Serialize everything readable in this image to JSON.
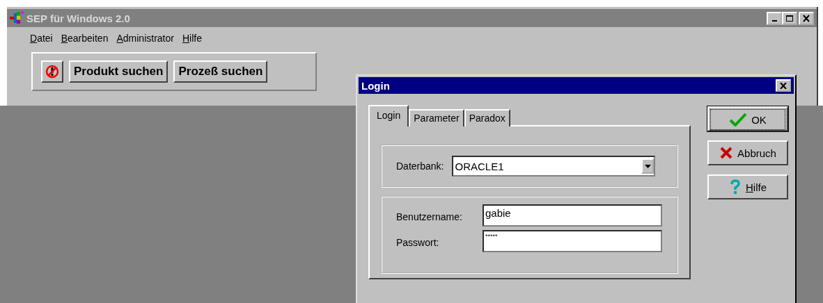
{
  "window": {
    "title": "SEP für Windows 2.0"
  },
  "menu": [
    "Datei",
    "Bearbeiten",
    "Administrator",
    "Hilfe"
  ],
  "toolbar": [
    {
      "kind": "icon"
    },
    {
      "kind": "text",
      "label": "Produkt suchen"
    },
    {
      "kind": "text",
      "label": "Prozeß suchen"
    }
  ],
  "dialog": {
    "title": "Login",
    "tabs": [
      {
        "label": "Login",
        "selected": true
      },
      {
        "label": "Parameter",
        "selected": false
      },
      {
        "label": "Paradox",
        "selected": false
      }
    ],
    "database": {
      "label": "Daterbank:",
      "value": "ORACLE1"
    },
    "username": {
      "label": "Benutzername:",
      "value": "gabie"
    },
    "password": {
      "label": "Passwort:",
      "value": "*****"
    },
    "buttons": [
      {
        "kind": "ok",
        "label": "OK",
        "default": true
      },
      {
        "kind": "cancel",
        "label": "Abbruch",
        "default": false
      },
      {
        "kind": "help",
        "label": "Hilfe",
        "default": false
      }
    ]
  }
}
